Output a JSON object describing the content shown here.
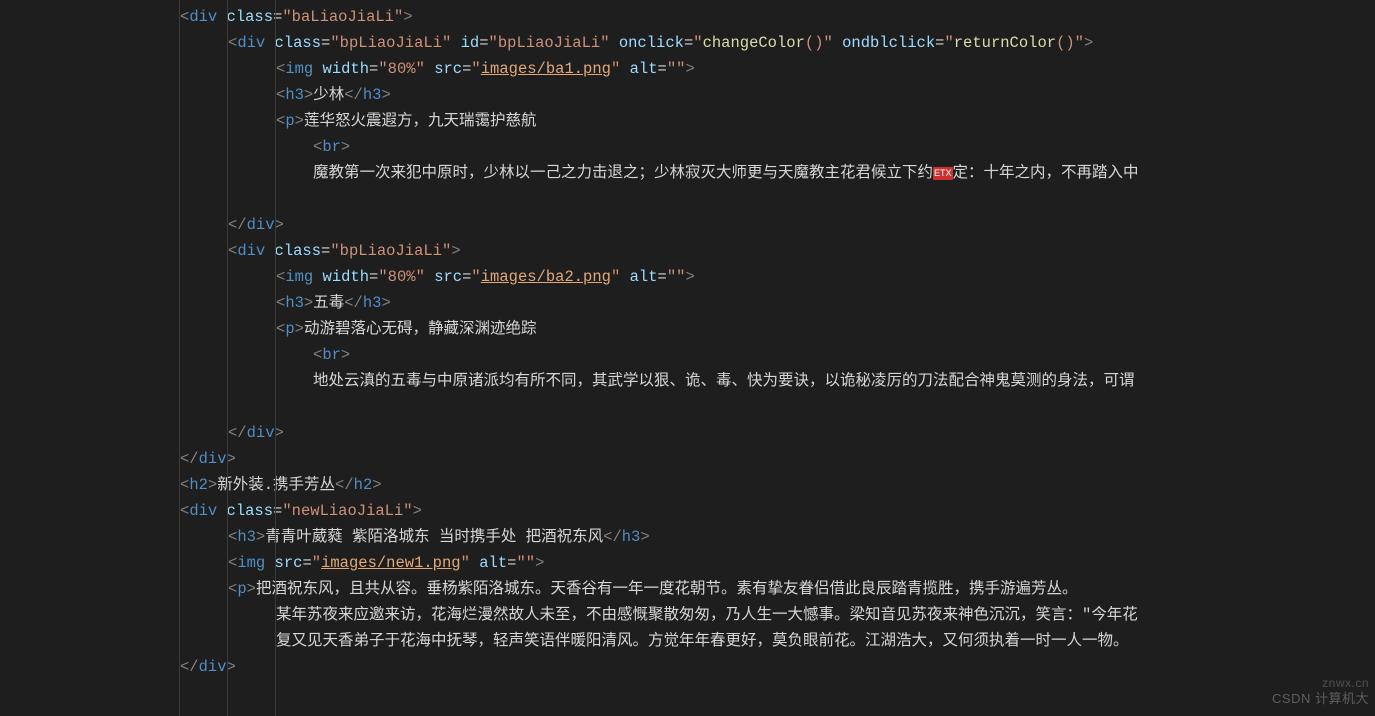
{
  "watermark_top": "znwx.cn",
  "watermark_bottom": "CSDN 计算机大",
  "etx_label": "ETX",
  "lines": {
    "l01_class": "baLiaoJiaLi",
    "l02_class": "bpLiaoJiaLi",
    "l02_id": "bpLiaoJiaLi",
    "l02_onclick": "changeColor",
    "l02_ondblclick": "returnColor",
    "l03_width": "80%",
    "l03_src": "images/ba1.png",
    "l03_alt": "",
    "l04_text": "少林",
    "l05_text": "莲华怒火震遐方，九天瑞霭护慈航",
    "l07_text_a": "魔教第一次来犯中原时，少林以一己之力击退之；少林寂灭大师更与天魔教主花君候立下约",
    "l07_text_b": "定：十年之内，不再踏入中",
    "l10_class": "bpLiaoJiaLi",
    "l11_width": "80%",
    "l11_src": "images/ba2.png",
    "l11_alt": "",
    "l12_text": "五毒",
    "l13_text": "动游碧落心无碍，静藏深渊迹绝踪",
    "l15_text": "地处云滇的五毒与中原诸派均有所不同，其武学以狠、诡、毒、快为要诀，以诡秘凌厉的刀法配合神鬼莫测的身法，可谓",
    "l19_text": "新外装.携手芳丛",
    "l20_class": "newLiaoJiaLi",
    "l21_text": "青青叶葳蕤 紫陌洛城东 当时携手处 把酒祝东风",
    "l22_src": "images/new1.png",
    "l22_alt": "",
    "l23_text": "把酒祝东风，且共从容。垂杨紫陌洛城东。天香谷有一年一度花朝节。素有挚友眷侣借此良辰踏青揽胜，携手游遍芳丛。",
    "l24_text": "某年苏夜来应邀来访，花海烂漫然故人未至，不由感慨聚散匆匆，乃人生一大憾事。梁知音见苏夜来神色沉沉，笑言：\"今年花",
    "l25_text": "复又见天香弟子于花海中抚琴，轻声笑语伴暖阳清风。方觉年年春更好，莫负眼前花。江湖浩大，又何须执着一时一人一物。"
  }
}
